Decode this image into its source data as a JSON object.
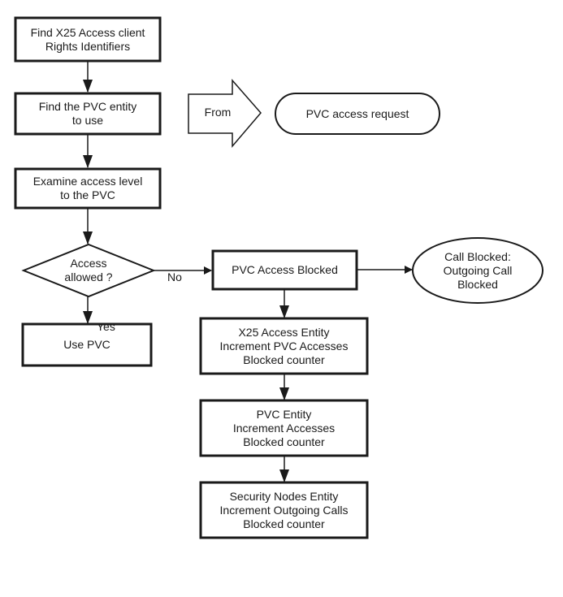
{
  "diagram": {
    "nodes": {
      "find_rights": {
        "label": "Find X25 Access client\nRights Identifiers",
        "shape": "process"
      },
      "find_pvc": {
        "label": "Find the PVC entity\nto use",
        "shape": "process"
      },
      "examine": {
        "label": "Examine access level\nto the PVC",
        "shape": "process"
      },
      "decision": {
        "label": "Access\nallowed ?",
        "shape": "decision"
      },
      "use_pvc": {
        "label": "Use PVC",
        "shape": "process"
      },
      "blocked": {
        "label": "PVC Access Blocked",
        "shape": "process"
      },
      "call_blocked": {
        "label": "Call Blocked:\nOutgoing Call\nBlocked",
        "shape": "ellipse"
      },
      "x25_counter": {
        "label": "X25 Access Entity\nIncrement PVC Accesses\nBlocked counter",
        "shape": "process"
      },
      "pvc_counter": {
        "label": "PVC Entity\nIncrement Accesses\nBlocked counter",
        "shape": "process"
      },
      "security_counter": {
        "label": "Security Nodes Entity\nIncrement Outgoing Calls\nBlocked counter",
        "shape": "process"
      }
    },
    "entry": {
      "from_label": "From",
      "source_label": "PVC access request"
    },
    "edges": [
      {
        "from": "find_rights",
        "to": "find_pvc",
        "label": ""
      },
      {
        "from": "find_pvc",
        "to": "examine",
        "label": ""
      },
      {
        "from": "examine",
        "to": "decision",
        "label": ""
      },
      {
        "from": "decision",
        "to": "blocked",
        "label": "No"
      },
      {
        "from": "decision",
        "to": "use_pvc",
        "label": "Yes"
      },
      {
        "from": "blocked",
        "to": "call_blocked",
        "label": ""
      },
      {
        "from": "blocked",
        "to": "x25_counter",
        "label": ""
      },
      {
        "from": "x25_counter",
        "to": "pvc_counter",
        "label": ""
      },
      {
        "from": "pvc_counter",
        "to": "security_counter",
        "label": ""
      }
    ],
    "edge_labels": {
      "no": "No",
      "yes": "Yes"
    }
  }
}
